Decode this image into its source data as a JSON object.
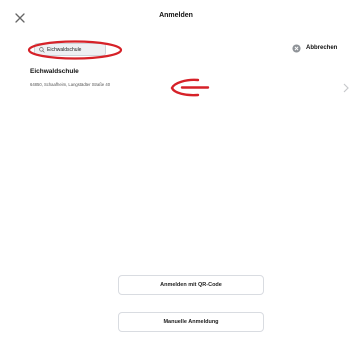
{
  "header": {
    "title": "Anmelden",
    "close_icon": "close-icon"
  },
  "search": {
    "value": "Eichwaldschule",
    "clear_icon": "clear-icon",
    "cancel_label": "Abbrechen"
  },
  "result": {
    "name": "Eichwaldschule",
    "address": "64850, Schaafheim, Langstädter Straße 40"
  },
  "actions": {
    "qr_label": "Anmelden mit QR-Code",
    "manual_label": "Manuelle Anmeldung"
  },
  "colors": {
    "annotation": "#d62128",
    "text": "#111111",
    "field_bg": "#eef0f3"
  }
}
